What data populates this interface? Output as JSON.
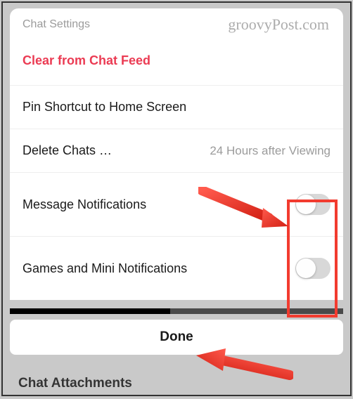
{
  "watermark": "groovyPost.com",
  "header": {
    "title": "Chat Settings"
  },
  "rows": {
    "clear": {
      "label": "Clear from Chat Feed"
    },
    "pin": {
      "label": "Pin Shortcut to Home Screen"
    },
    "delete": {
      "label": "Delete Chats …",
      "secondary": "24 Hours after Viewing"
    },
    "msg_notif": {
      "label": "Message Notifications",
      "toggle": false
    },
    "games_notif": {
      "label": "Games and Mini Notifications",
      "toggle": false
    }
  },
  "done": {
    "label": "Done"
  },
  "background_row": {
    "label": "Chat Attachments"
  },
  "annotation": {
    "color": "#f23b2f"
  }
}
